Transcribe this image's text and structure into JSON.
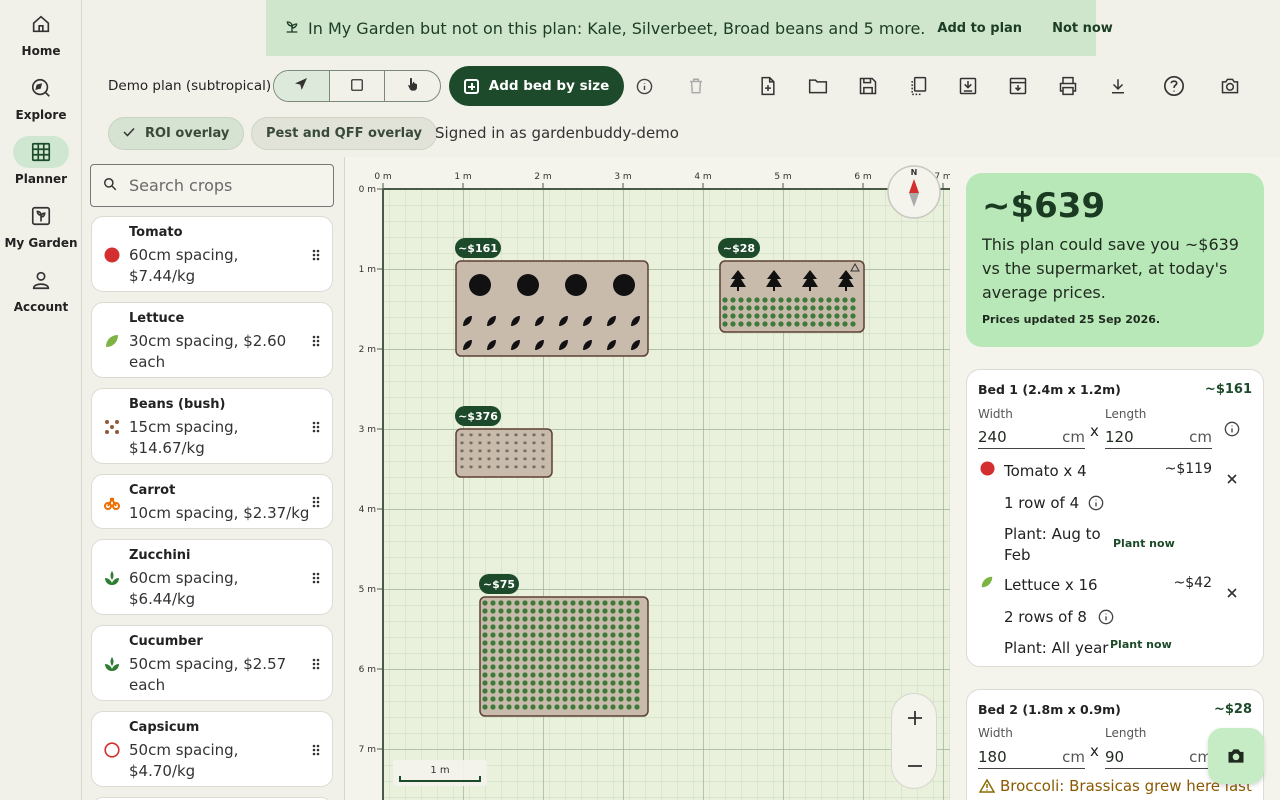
{
  "nav": {
    "home": "Home",
    "explore": "Explore",
    "planner": "Planner",
    "my_garden": "My Garden",
    "account": "Account"
  },
  "banner": {
    "message": "In My Garden but not on this plan: Kale, Silverbeet, Broad beans and 5 more.",
    "add_label": "Add to plan",
    "dismiss_label": "Not now"
  },
  "toolbar": {
    "plan_name": "Demo plan (subtropical)",
    "add_bed_label": "Add bed by size"
  },
  "overlays": {
    "roi_label": "ROI overlay",
    "pest_label": "Pest and QFF overlay",
    "signed_in": "Signed in as gardenbuddy-demo"
  },
  "search": {
    "placeholder": "Search crops"
  },
  "crops": [
    {
      "name": "Tomato",
      "desc": "60cm spacing, $7.44/kg",
      "icon": "red-circle-icon",
      "color": "#d32f2f"
    },
    {
      "name": "Lettuce",
      "desc": "30cm spacing, $2.60 each",
      "icon": "leaf-icon",
      "color": "#7cb342"
    },
    {
      "name": "Beans (bush)",
      "desc": "15cm spacing, $14.67/kg",
      "icon": "beans-icon",
      "color": "#8d5a3b"
    },
    {
      "name": "Carrot",
      "desc": "10cm spacing, $2.37/kg",
      "icon": "carrot-icon",
      "color": "#ef6c00"
    },
    {
      "name": "Zucchini",
      "desc": "60cm spacing, $6.44/kg",
      "icon": "plant-icon",
      "color": "#2e7d32"
    },
    {
      "name": "Cucumber",
      "desc": "50cm spacing, $2.57 each",
      "icon": "plant-icon",
      "color": "#2e7d32"
    },
    {
      "name": "Capsicum",
      "desc": "50cm spacing, $4.70/kg",
      "icon": "outline-circle-icon",
      "color": "#d32f2f"
    }
  ],
  "canvas": {
    "x_ticks": [
      "0 m",
      "1 m",
      "2 m",
      "3 m",
      "4 m",
      "5 m",
      "6 m",
      "7 m"
    ],
    "y_ticks": [
      "0 m",
      "1 m",
      "2 m",
      "3 m",
      "4 m",
      "5 m",
      "6 m",
      "7 m"
    ],
    "compass_label": "N",
    "scale_label": "1 m",
    "bed_labels": [
      "~$161",
      "~$28",
      "~$376",
      "~$75"
    ]
  },
  "savings": {
    "amount": "~$639",
    "text": "This plan could save you ~$639 vs the supermarket, at today's average prices.",
    "updated": "Prices updated 25 Sep 2026."
  },
  "beds": [
    {
      "title": "Bed 1 (2.4m x 1.2m)",
      "value": "~$161",
      "width_label": "Width",
      "width": "240",
      "length_label": "Length",
      "length": "120",
      "unit": "cm",
      "times": "x",
      "crops": [
        {
          "name": "Tomato x 4",
          "value": "~$119",
          "rows": "1 row of 4",
          "plant": "Plant: Aug to Feb",
          "plant_now": "Plant now"
        },
        {
          "name": "Lettuce x 16",
          "value": "~$42",
          "rows": "2 rows of 8",
          "plant": "Plant: All year",
          "plant_now": "Plant now"
        }
      ]
    },
    {
      "title": "Bed 2 (1.8m x 0.9m)",
      "value": "~$28",
      "width_label": "Width",
      "width": "180",
      "length_label": "Length",
      "length": "90",
      "unit": "cm",
      "times": "x",
      "warning": "Broccoli: Brassicas grew here last"
    }
  ],
  "colors": {
    "accent": "#1c4a2a",
    "banner_bg": "#cfe6cd",
    "savings_bg": "#b9e8b8",
    "bed_fill": "#c9bbab",
    "grid_bg": "#e9f0dc"
  }
}
